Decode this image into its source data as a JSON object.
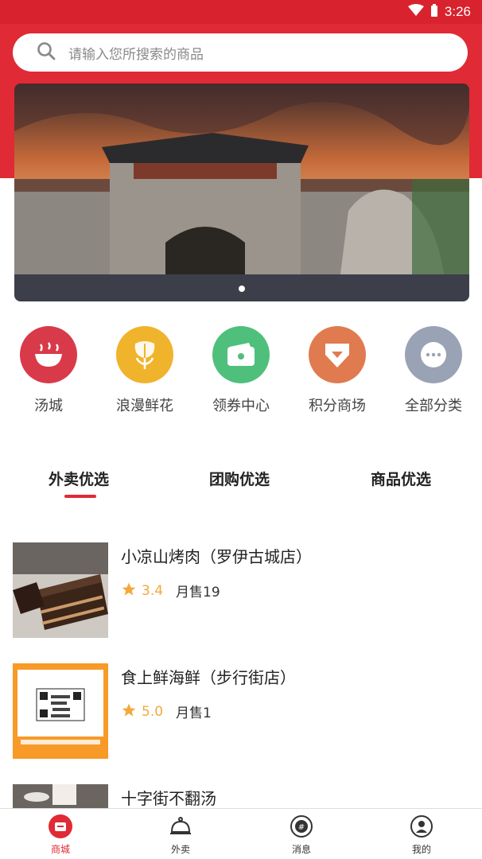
{
  "status_bar": {
    "time": "3:26",
    "icons": [
      "wifi-icon",
      "battery-icon"
    ]
  },
  "search": {
    "placeholder": "请输入您所搜索的商品",
    "icon": "search-icon"
  },
  "banner": {
    "image": "ancient-city-gate-photo",
    "page_indicator": {
      "count": 1,
      "active": 0
    }
  },
  "categories": [
    {
      "label": "汤城",
      "icon": "soup-bowl-icon",
      "color": "#d93a4a"
    },
    {
      "label": "浪漫鲜花",
      "icon": "flower-icon",
      "color": "#f0b32c"
    },
    {
      "label": "领券中心",
      "icon": "wallet-icon",
      "color": "#4fbf7c"
    },
    {
      "label": "积分商场",
      "icon": "tag-icon",
      "color": "#e07b4f"
    },
    {
      "label": "全部分类",
      "icon": "more-icon",
      "color": "#9aa3b5"
    }
  ],
  "tabs": {
    "items": [
      "外卖优选",
      "团购优选",
      "商品优选"
    ],
    "active": 0,
    "accent": "#e02a35"
  },
  "shops": [
    {
      "name": "小凉山烤肉（罗伊古城店）",
      "rating": "3.4",
      "sales": "月售19",
      "thumb": "chocolate-cake-photo"
    },
    {
      "name": "食上鲜海鲜（步行街店）",
      "rating": "5.0",
      "sales": "月售1",
      "thumb": "qr-code-receipt-photo"
    },
    {
      "name": "十字街不翻汤",
      "rating": "",
      "sales": "",
      "thumb": "teapot-photo"
    }
  ],
  "tabbar": {
    "items": [
      {
        "label": "商城",
        "icon": "mall-icon",
        "active": true
      },
      {
        "label": "外卖",
        "icon": "cloche-icon",
        "active": false
      },
      {
        "label": "消息",
        "icon": "message-icon",
        "active": false
      },
      {
        "label": "我的",
        "icon": "user-icon",
        "active": false
      }
    ]
  }
}
